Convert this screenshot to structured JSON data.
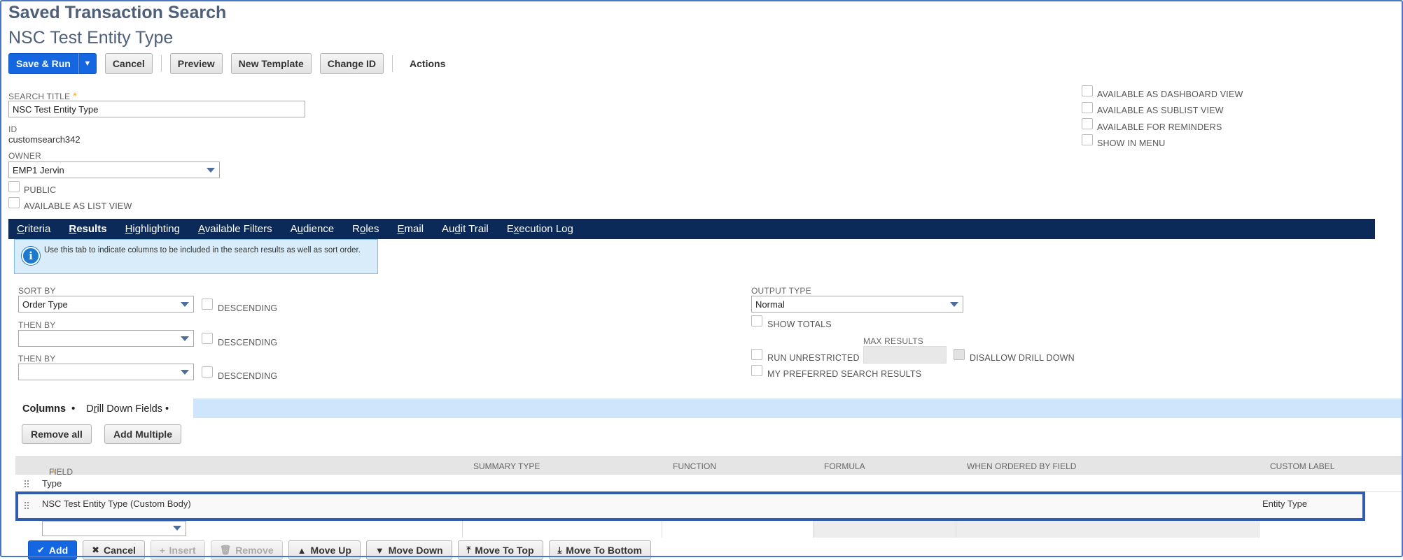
{
  "header": {
    "title": "Saved Transaction Search",
    "subtitle": "NSC Test Entity Type"
  },
  "toolbar": {
    "save_run": "Save & Run",
    "cancel": "Cancel",
    "preview": "Preview",
    "new_template": "New Template",
    "change_id": "Change ID",
    "actions": "Actions"
  },
  "form": {
    "search_title_label": "SEARCH TITLE",
    "search_title_value": "NSC Test Entity Type",
    "id_label": "ID",
    "id_value": "customsearch342",
    "owner_label": "OWNER",
    "owner_value": "EMP1 Jervin",
    "public_label": "PUBLIC",
    "available_list_view": "AVAILABLE AS LIST VIEW",
    "right_checks": [
      "AVAILABLE AS DASHBOARD VIEW",
      "AVAILABLE AS SUBLIST VIEW",
      "AVAILABLE FOR REMINDERS",
      "SHOW IN MENU"
    ]
  },
  "tabs": [
    {
      "pre": "",
      "ul": "C",
      "post": "riteria"
    },
    {
      "pre": "",
      "ul": "R",
      "post": "esults"
    },
    {
      "pre": "",
      "ul": "H",
      "post": "ighlighting"
    },
    {
      "pre": "",
      "ul": "A",
      "post": "vailable Filters"
    },
    {
      "pre": "A",
      "ul": "u",
      "post": "dience"
    },
    {
      "pre": "R",
      "ul": "o",
      "post": "les"
    },
    {
      "pre": "",
      "ul": "E",
      "post": "mail"
    },
    {
      "pre": "Au",
      "ul": "d",
      "post": "it Trail"
    },
    {
      "pre": "E",
      "ul": "x",
      "post": "ecution Log"
    }
  ],
  "info_text": "Use this tab to indicate columns to be included in the search results as well as sort order.",
  "results": {
    "sort_by_label": "SORT BY",
    "sort_by_value": "Order Type",
    "then_by_label": "THEN BY",
    "descending": "DESCENDING",
    "output_type_label": "OUTPUT TYPE",
    "output_type_value": "Normal",
    "show_totals": "SHOW TOTALS",
    "max_results_label": "MAX RESULTS",
    "run_unrestricted": "RUN UNRESTRICTED",
    "disallow_drill_down": "DISALLOW DRILL DOWN",
    "my_preferred": "MY PREFERRED SEARCH RESULTS"
  },
  "subtabs": {
    "columns_pre": "Co",
    "columns_ul": "l",
    "columns_post": "umns",
    "drill_pre": "D",
    "drill_ul": "r",
    "drill_post": "ill Down Fields",
    "dot": "•"
  },
  "sublist_buttons": {
    "remove_all": "Remove all",
    "add_multiple": "Add Multiple"
  },
  "columns_header": {
    "field": "FIELD",
    "summary_type": "SUMMARY TYPE",
    "function": "FUNCTION",
    "formula": "FORMULA",
    "when_ordered": "WHEN ORDERED BY FIELD",
    "custom_label": "CUSTOM LABEL"
  },
  "rows": [
    {
      "field": "Type",
      "custom_label": ""
    },
    {
      "field": "NSC Test Entity Type (Custom Body)",
      "custom_label": "Entity Type"
    }
  ],
  "row_actions": {
    "add": "Add",
    "cancel": "Cancel",
    "insert": "Insert",
    "remove": "Remove",
    "move_up": "Move Up",
    "move_down": "Move Down",
    "move_top": "Move To Top",
    "move_bottom": "Move To Bottom"
  },
  "colors": {
    "primary": "#1467e0",
    "nav_bar": "#0b2a59",
    "highlight_border": "#2f5cb0",
    "required": "#f39b2b"
  }
}
